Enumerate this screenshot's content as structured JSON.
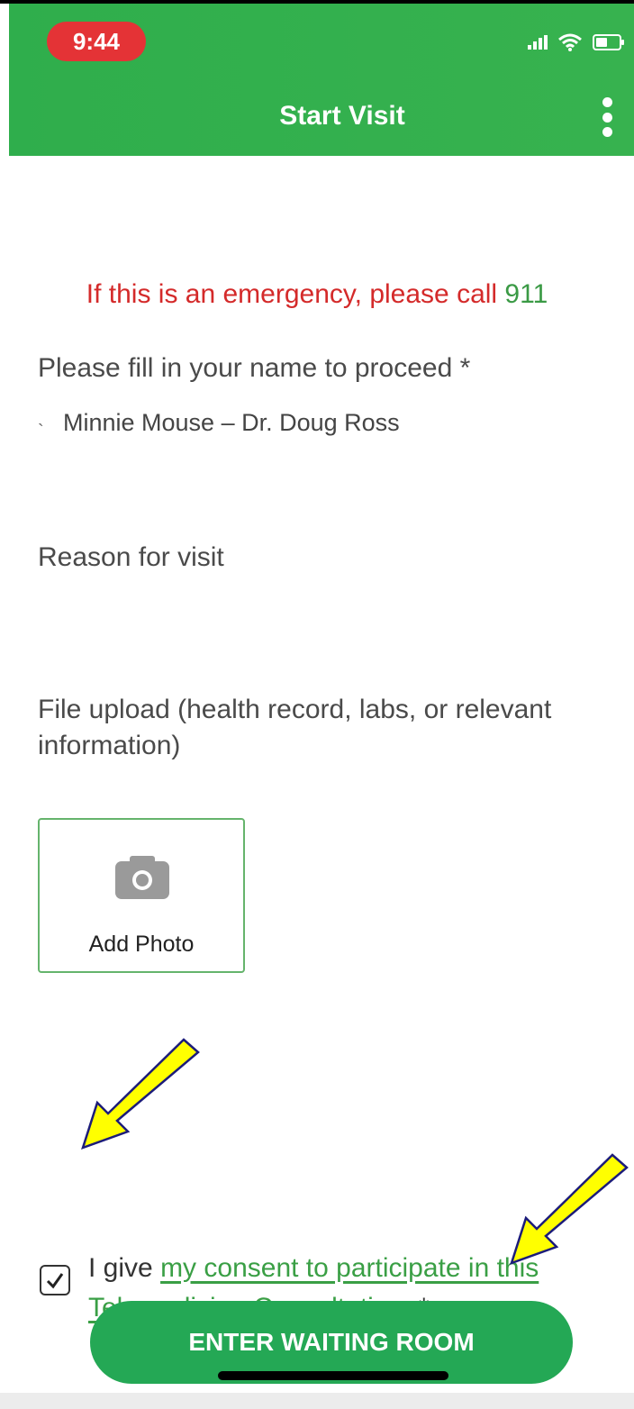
{
  "status_bar": {
    "time": "9:44"
  },
  "header": {
    "title": "Start Visit",
    "menu_icon": "kebab-menu-icon"
  },
  "form": {
    "emergency_text": "If this is an emergency, please call",
    "emergency_number": "911",
    "name_label": "Please fill in your name to proceed *",
    "name_value": "Minnie Mouse – Dr. Doug Ross",
    "name_mark": "`",
    "reason_label": "Reason for visit",
    "file_upload_label": "File upload (health record, labs, or relevant information)",
    "add_photo_label": "Add Photo",
    "consent_prefix": "I give",
    "consent_link": "my consent to participate in this Telemedicine Consultation",
    "consent_suffix": ". *",
    "consent_checked": true,
    "enter_button": "ENTER WAITING ROOM"
  },
  "colors": {
    "header_green": "#34b04e",
    "emergency_red": "#d42a2a",
    "link_green": "#3a9f45",
    "button_green": "#24a855",
    "annotation_arrow": "#ffff00"
  }
}
